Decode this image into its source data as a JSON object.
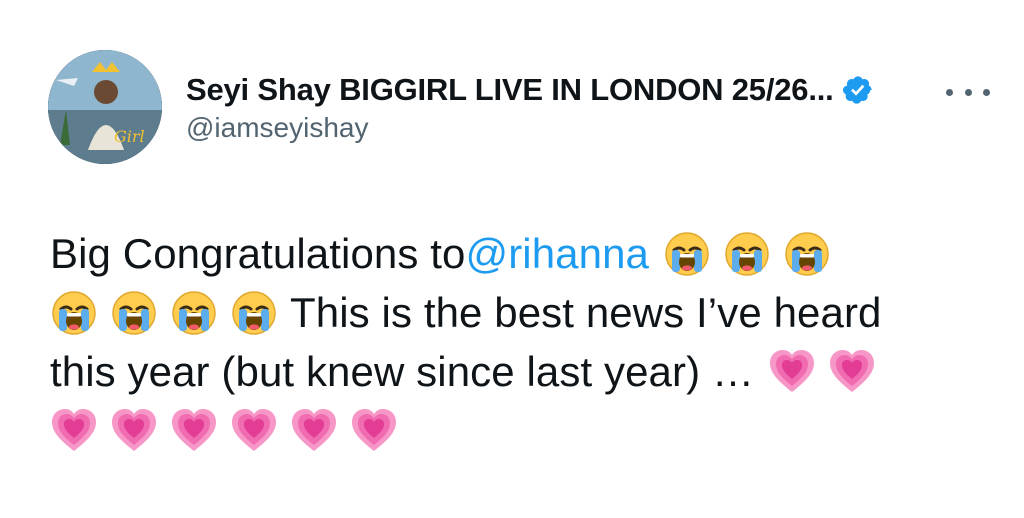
{
  "tweet": {
    "author": {
      "display_name": "Seyi Shay BIGGIRL LIVE IN LONDON 25/26...",
      "handle": "@iamseyishay",
      "avatar_icon": "profile-avatar",
      "verified_icon": "verified-badge-icon",
      "verified_color": "#1d9bf0"
    },
    "more_icon": "more-options-icon",
    "body": {
      "line1_text": "Big Congratulations to ",
      "line1_mention": "@rihanna",
      "line2_text": "This is the best news I’ve heard",
      "line3_text": "this year (but knew since last year) …",
      "crying_emoji_icon": "loudly-crying-face-emoji",
      "heart_emoji_icon": "growing-heart-emoji",
      "mention_color": "#1d9bf0"
    }
  }
}
